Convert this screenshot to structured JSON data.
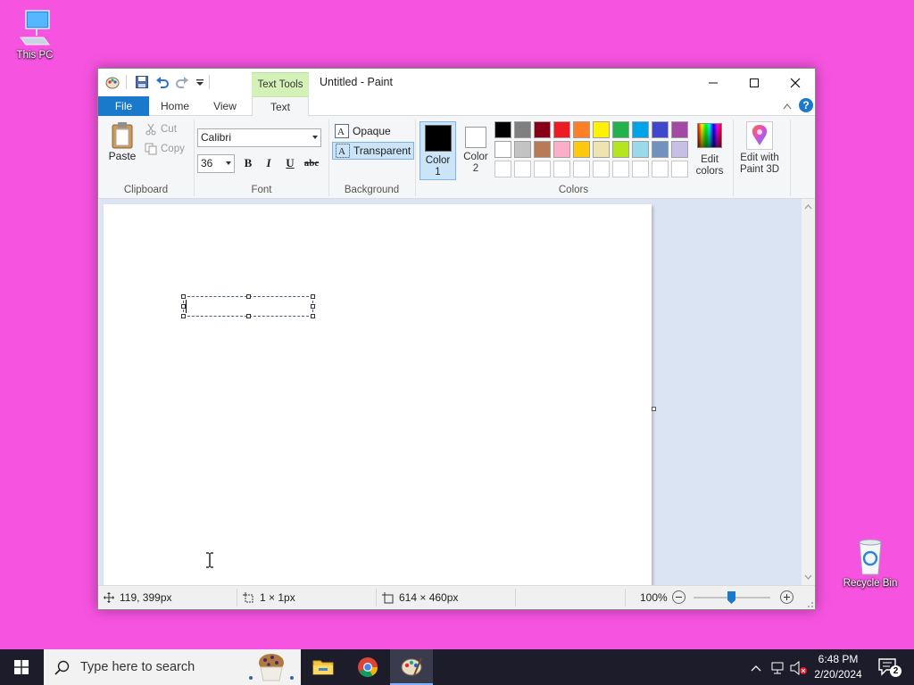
{
  "desktop": {
    "icons": [
      {
        "label": "This PC",
        "icon": "computer-icon"
      },
      {
        "label": "Recycle Bin",
        "icon": "recycle-bin-icon"
      }
    ]
  },
  "window": {
    "title": "Untitled - Paint",
    "contextual_tab": "Text Tools",
    "tabs": [
      {
        "label": "File"
      },
      {
        "label": "Home"
      },
      {
        "label": "View"
      },
      {
        "label": "Text",
        "active": true
      }
    ]
  },
  "ribbon": {
    "clipboard": {
      "group": "Clipboard",
      "paste": "Paste",
      "cut": "Cut",
      "copy": "Copy"
    },
    "font": {
      "group": "Font",
      "family": "Calibri",
      "size": "36",
      "bold": "B",
      "italic": "I",
      "underline": "U",
      "strike": "abc"
    },
    "background": {
      "group": "Background",
      "opaque": "Opaque",
      "transparent": "Transparent",
      "selected": "Transparent"
    },
    "colors": {
      "group": "Colors",
      "color1_label": "Color",
      "color1_num": "1",
      "color2_label": "Color",
      "color2_num": "2",
      "color1_value": "#000000",
      "color2_value": "#ffffff",
      "palette_row1": [
        "#000000",
        "#7f7f7f",
        "#880015",
        "#ed1c24",
        "#ff7f27",
        "#fff200",
        "#22b14c",
        "#00a2e8",
        "#3f48cc",
        "#a349a4"
      ],
      "palette_row2": [
        "#ffffff",
        "#c3c3c3",
        "#b97a57",
        "#ffaec9",
        "#ffc90e",
        "#efe4b0",
        "#b5e61d",
        "#99d9ea",
        "#7092be",
        "#c8bfe7"
      ],
      "edit_colors_line1": "Edit",
      "edit_colors_line2": "colors"
    },
    "paint3d": {
      "line1": "Edit with",
      "line2": "Paint 3D"
    }
  },
  "status": {
    "cursor_pos": "119, 399px",
    "selection_size": "1 × 1px",
    "canvas_size": "614 × 460px",
    "zoom": "100%"
  },
  "taskbar": {
    "search_placeholder": "Type here to search",
    "time": "6:48 PM",
    "date": "2/20/2024",
    "notification_count": "2"
  }
}
